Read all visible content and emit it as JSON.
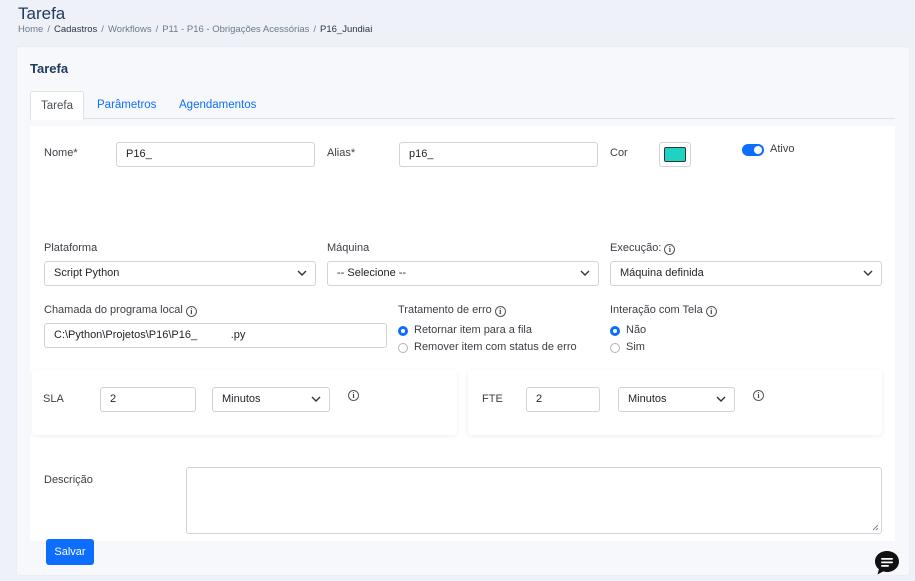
{
  "page": {
    "title": "Tarefa",
    "breadcrumb": [
      "Home",
      "Cadastros",
      "Workflows",
      "P11 - P16 - Obrigações Acessórias",
      "P16_Jundiai"
    ]
  },
  "card": {
    "title": "Tarefa"
  },
  "tabs": [
    {
      "label": "Tarefa",
      "active": true
    },
    {
      "label": "Parâmetros",
      "active": false
    },
    {
      "label": "Agendamentos",
      "active": false
    }
  ],
  "form": {
    "nome": {
      "label": "Nome*",
      "value": "P16_"
    },
    "alias": {
      "label": "Alias*",
      "value": "p16_"
    },
    "cor": {
      "label": "Cor",
      "value": "#1fd3c4"
    },
    "ativo": {
      "label": "Ativo",
      "checked": true
    },
    "plataforma": {
      "label": "Plataforma",
      "value": "Script Python"
    },
    "maquina": {
      "label": "Máquina",
      "value": "-- Selecione --"
    },
    "execucao": {
      "label": "Execução:",
      "value": "Máquina definida"
    },
    "chamada": {
      "label": "Chamada do programa local",
      "value": "C:\\Python\\Projetos\\P16\\P16_           .py"
    },
    "tratamento_erro": {
      "label": "Tratamento de erro",
      "options": [
        {
          "label": "Retornar item para a fila",
          "selected": true
        },
        {
          "label": "Remover item com status de erro",
          "selected": false
        }
      ]
    },
    "interacao_tela": {
      "label": "Interação com Tela",
      "options": [
        {
          "label": "Não",
          "selected": true
        },
        {
          "label": "Sim",
          "selected": false
        }
      ]
    },
    "sla": {
      "label": "SLA",
      "value": "2",
      "unit": "Minutos"
    },
    "fte": {
      "label": "FTE",
      "value": "2",
      "unit": "Minutos"
    },
    "descricao": {
      "label": "Descrição",
      "value": ""
    }
  },
  "buttons": {
    "save": "Salvar"
  },
  "colors": {
    "accent": "#0d6efd",
    "title": "#1f3a60",
    "swatch": "#1fd3c4"
  },
  "icons": {
    "info": "info-icon",
    "chevron": "chevron-down-icon",
    "chat": "chat-icon"
  }
}
